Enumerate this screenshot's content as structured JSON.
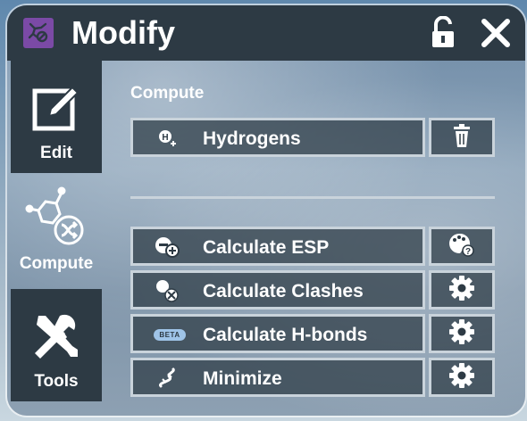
{
  "window": {
    "title": "Modify",
    "icons": {
      "app": "molecule-icon",
      "lock": "unlock-icon",
      "close": "close-icon"
    }
  },
  "sidebar": {
    "tabs": [
      {
        "label": "Edit",
        "icon": "edit-icon",
        "active": false
      },
      {
        "label": "Compute",
        "icon": "compute-icon",
        "active": true
      },
      {
        "label": "Tools",
        "icon": "tools-icon",
        "active": false
      }
    ]
  },
  "compute": {
    "section_title": "Compute",
    "hydrogens": {
      "label": "Hydrogens",
      "icon": "hydrogen-icon",
      "side_icon": "trash-icon"
    },
    "actions": [
      {
        "label": "Calculate ESP",
        "icon": "esp-icon",
        "side_icon": "palette-help-icon"
      },
      {
        "label": "Calculate Clashes",
        "icon": "clashes-icon",
        "side_icon": "gear-icon"
      },
      {
        "label": "Calculate H-bonds",
        "icon": "beta-badge",
        "badge": "BETA",
        "side_icon": "gear-icon"
      },
      {
        "label": "Minimize",
        "icon": "minimize-icon",
        "side_icon": "gear-icon"
      }
    ]
  },
  "colors": {
    "bar": "#2d3a44",
    "border": "#c9d3db",
    "app_icon": "#7b4aa6",
    "beta": "#9fc4e8"
  }
}
